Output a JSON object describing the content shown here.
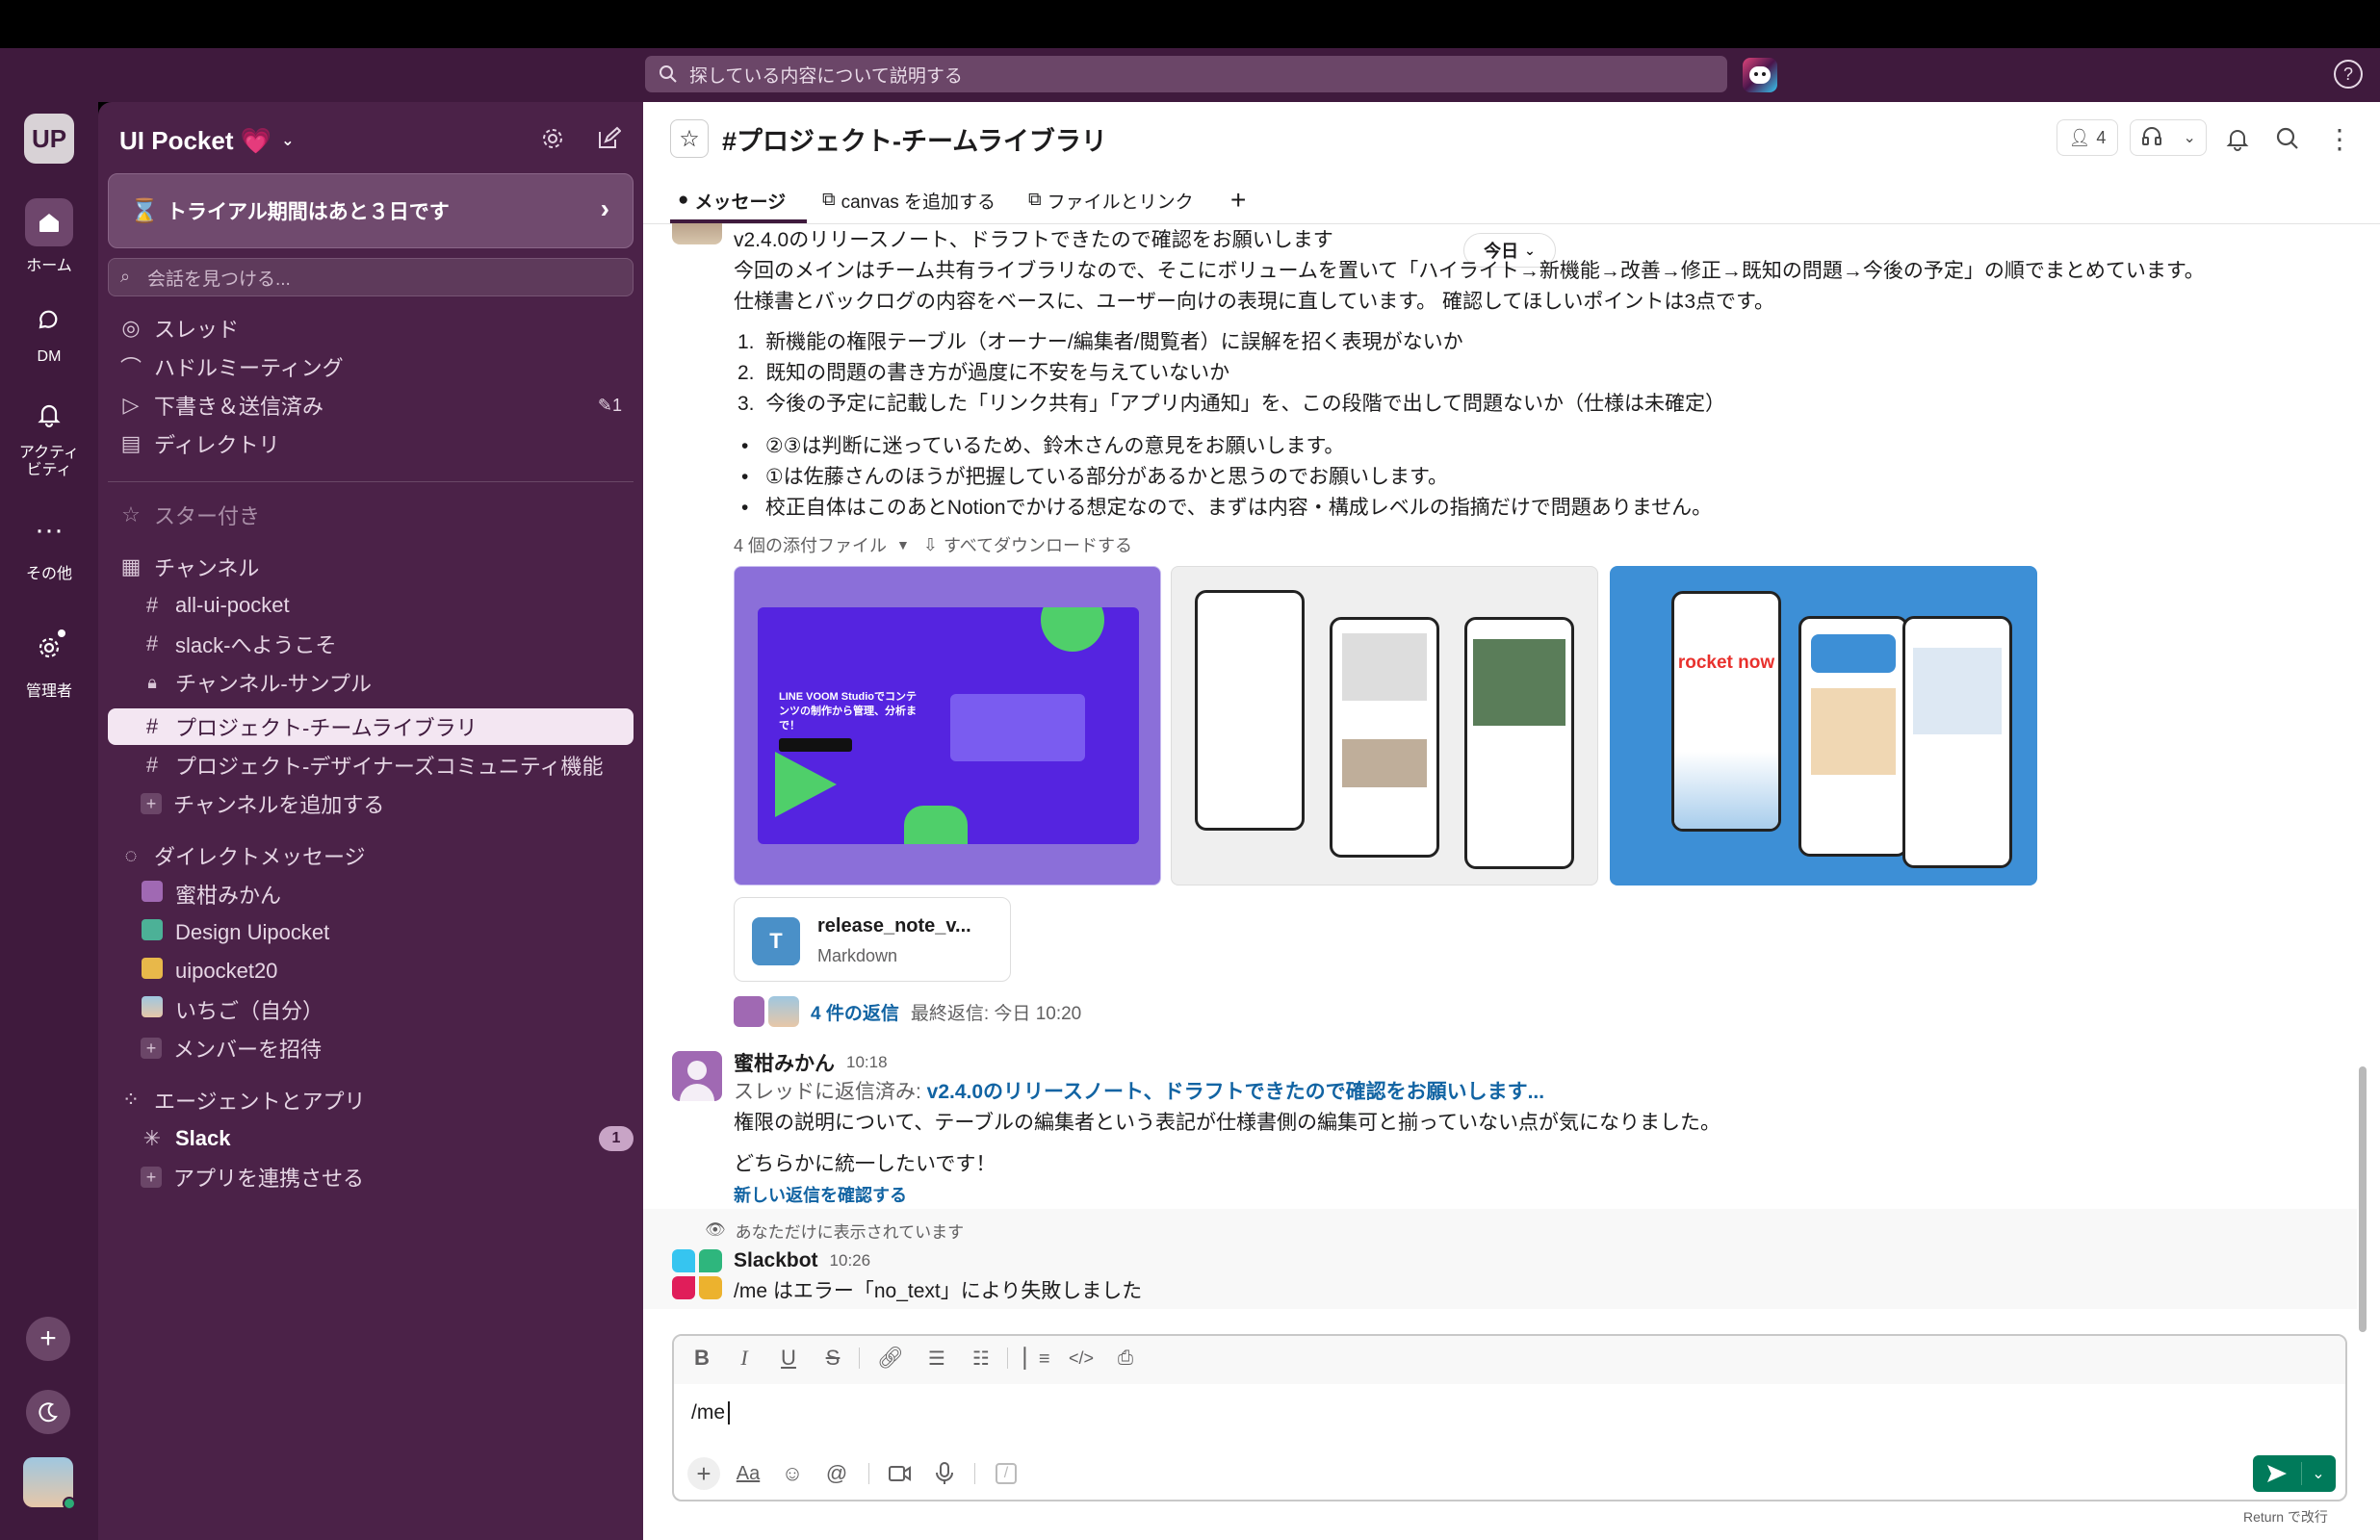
{
  "topbar": {
    "search_placeholder": "探している内容について説明する"
  },
  "rail": {
    "workspace_initials": "UP",
    "home": "ホーム",
    "dm": "DM",
    "activity": "アクティ\nビティ",
    "more": "その他",
    "admin": "管理者"
  },
  "sidebar": {
    "workspace": "UI Pocket 💗",
    "trial_banner": "トライアル期間はあと３日です",
    "find_placeholder": "会話を見つける...",
    "nav": [
      {
        "label": "スレッド"
      },
      {
        "label": "ハドルミーティング"
      },
      {
        "label": "下書き＆送信済み",
        "badge": "1"
      },
      {
        "label": "ディレクトリ"
      }
    ],
    "starred": "スター付き",
    "channels_header": "チャンネル",
    "channels": [
      "all-ui-pocket",
      "slack-へようこそ",
      "チャンネル-サンプル",
      "プロジェクト-チームライブラリ",
      "プロジェクト-デザイナーズコミュニティ機能"
    ],
    "add_channel": "チャンネルを追加する",
    "dm_header": "ダイレクトメッセージ",
    "dms": [
      "蜜柑みかん",
      "Design Uipocket",
      "uipocket20",
      "いちご（自分）"
    ],
    "invite": "メンバーを招待",
    "apps_header": "エージェントとアプリ",
    "slack_app": "Slack",
    "slack_badge": "1",
    "connect_app": "アプリを連携させる"
  },
  "channel": {
    "title": "#プロジェクト-チームライブラリ",
    "member_count": "4",
    "tabs": {
      "messages": "メッセージ",
      "canvas": "canvas を追加する",
      "files": "ファイルとリンク"
    },
    "date_pill": "今日"
  },
  "message1": {
    "line1": "v2.4.0のリリースノート、ドラフトできたので確認をお願いします",
    "line2": "今回のメインはチーム共有ライブラリなので、そこにボリュームを置いて「ハイライト→新機能→改善→修正→既知の問題→今後の予定」の順でまとめています。",
    "line3": "仕様書とバックログの内容をベースに、ユーザー向けの表現に直しています。 確認してほしいポイントは3点です。",
    "ol": [
      "新機能の権限テーブル（オーナー/編集者/閲覧者）に誤解を招く表現がないか",
      "既知の問題の書き方が過度に不安を与えていないか",
      "今後の予定に記載した「リンク共有」「アプリ内通知」を、この段階で出して問題ないか（仕様は未確定）"
    ],
    "ul": [
      "②③は判断に迷っているため、鈴木さんの意見をお願いします。",
      "①は佐藤さんのほうが把握している部分があるかと思うのでお願いします。",
      "校正自体はこのあとNotionでかける想定なので、まずは内容・構成レベルの指摘だけで問題ありません。"
    ],
    "attach_count": "4 個の添付ファイル",
    "download_all": "すべてダウンロードする",
    "thumb1_text": "LINE VOOM Studioでコンテンツの制作から管理、分析まで！",
    "thumb3_brand": "rocket now",
    "file_name": "release_note_v...",
    "file_type": "Markdown",
    "file_letter": "T",
    "replies": "4 件の返信",
    "last_reply": "最終返信: 今日 10:20"
  },
  "message2": {
    "author": "蜜柑みかん",
    "time": "10:18",
    "reply_prefix": "スレッドに返信済み: ",
    "reply_link": "v2.4.0のリリースノート、ドラフトできたので確認をお願いします...",
    "text1": "権限の説明について、テーブルの編集者という表記が仕様書側の編集可と揃っていない点が気になりました。",
    "text2": "どちらかに統一したいです！",
    "see_new": "新しい返信を確認する"
  },
  "message3": {
    "only_you": "あなただけに表示されています",
    "author": "Slackbot",
    "time": "10:26",
    "text": "/me はエラー「no_text」により失敗しました"
  },
  "composer": {
    "value": "/me",
    "hint": "Return で改行"
  },
  "colors": {
    "aubergine": "#3f1a3d",
    "sidebar": "#4b2248",
    "active": "#f3e6f2",
    "link": "#1264a3",
    "send": "#007a5a"
  }
}
